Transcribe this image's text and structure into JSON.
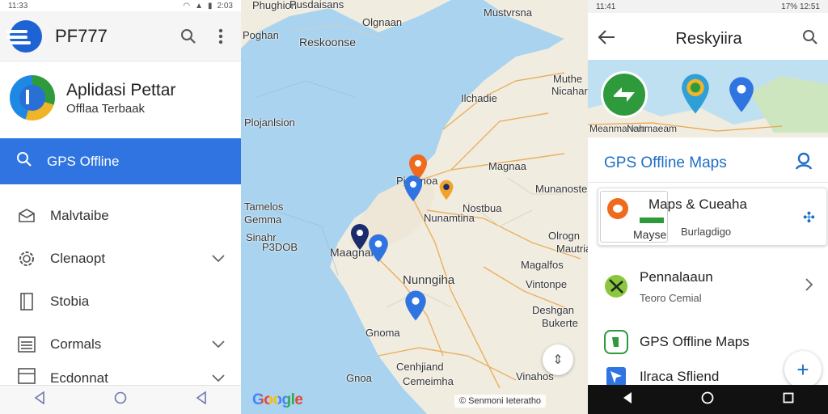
{
  "left": {
    "status": {
      "time": "11:33",
      "right": "2:03"
    },
    "appbar": {
      "title": "PF777",
      "search_icon": "search-icon",
      "more_icon": "more-vert-icon"
    },
    "profile": {
      "title": "Aplidasi Pettar",
      "subtitle": "Offlaa Terbaak"
    },
    "active_item": {
      "label": "GPS Offline"
    },
    "menu": [
      {
        "label": "Malvtaibe",
        "icon": "envelope-icon",
        "expandable": false
      },
      {
        "label": "Clenaopt",
        "icon": "gear-icon",
        "expandable": true
      },
      {
        "label": "Stobia",
        "icon": "page-icon",
        "expandable": false
      },
      {
        "label": "Cormals",
        "icon": "list-icon",
        "expandable": true
      },
      {
        "label": "Ecdonnat",
        "icon": "grid-icon",
        "expandable": true
      }
    ]
  },
  "map": {
    "labels": {
      "tl": "Phughion",
      "top_center": "Pusdaisans",
      "t2": "Olgnaan",
      "t3": "Mustvrsna",
      "left1": "Poghan",
      "center1": "Reskoonse",
      "r1": "Muthe",
      "r2": "Nicahara",
      "r3": "Ilchadie",
      "l2": "Plojanlsion",
      "c2": "Pionmoa",
      "r4": "Magnaa",
      "r5": "Munanostes",
      "m1": "Nostbua",
      "l3": "Tamelos",
      "l4": "Gemma",
      "m2": "Nunamtina",
      "r6": "Olrogn",
      "r7": "Mautriatia",
      "l5": "Sinahr",
      "l6": "P3DOB",
      "l7": "Maagnal",
      "r8": "Magalfos",
      "m3": "Nunngiha",
      "r9": "Vintonpe",
      "r10": "Deshgan",
      "r11": "Bukerte",
      "m4": "Gnoma",
      "m5": "Cenhjiand",
      "m6": "Cemeimha",
      "l8": "Gnoa",
      "r12": "Vinahos"
    },
    "logo": "Google",
    "footer": "© Senmoni Ieteratho",
    "fab_icon": "compass-icon"
  },
  "right": {
    "status": {
      "left": "11:41",
      "right": "17% 12:51"
    },
    "appbar": {
      "title": "Reskyiira",
      "back_icon": "back-arrow-icon",
      "search_icon": "search-icon"
    },
    "thumb_labels": {
      "a": "Meanmanem",
      "b": "Nahmaeam"
    },
    "section": {
      "title": "GPS Offline Maps"
    },
    "card": {
      "title": "Maps & Cueaha",
      "thumb_label": "Mayse",
      "subtitle": "Burlagdigo"
    },
    "items": [
      {
        "title": "Pennalaaun",
        "subtitle": "Teoro Cemial",
        "chevron": true
      },
      {
        "title": "GPS Offline Maps",
        "subtitle": "",
        "chevron": false
      },
      {
        "title": "Ilraca Sfliend",
        "subtitle": "",
        "chevron": false
      }
    ],
    "fab_label": "+"
  },
  "colors": {
    "primary_blue": "#2f74e0",
    "accent_blue": "#1e6fc4",
    "pin_orange": "#f06a1d",
    "pin_navy": "#1b2b6b",
    "water": "#a9d3ee",
    "land": "#f1ece0"
  }
}
